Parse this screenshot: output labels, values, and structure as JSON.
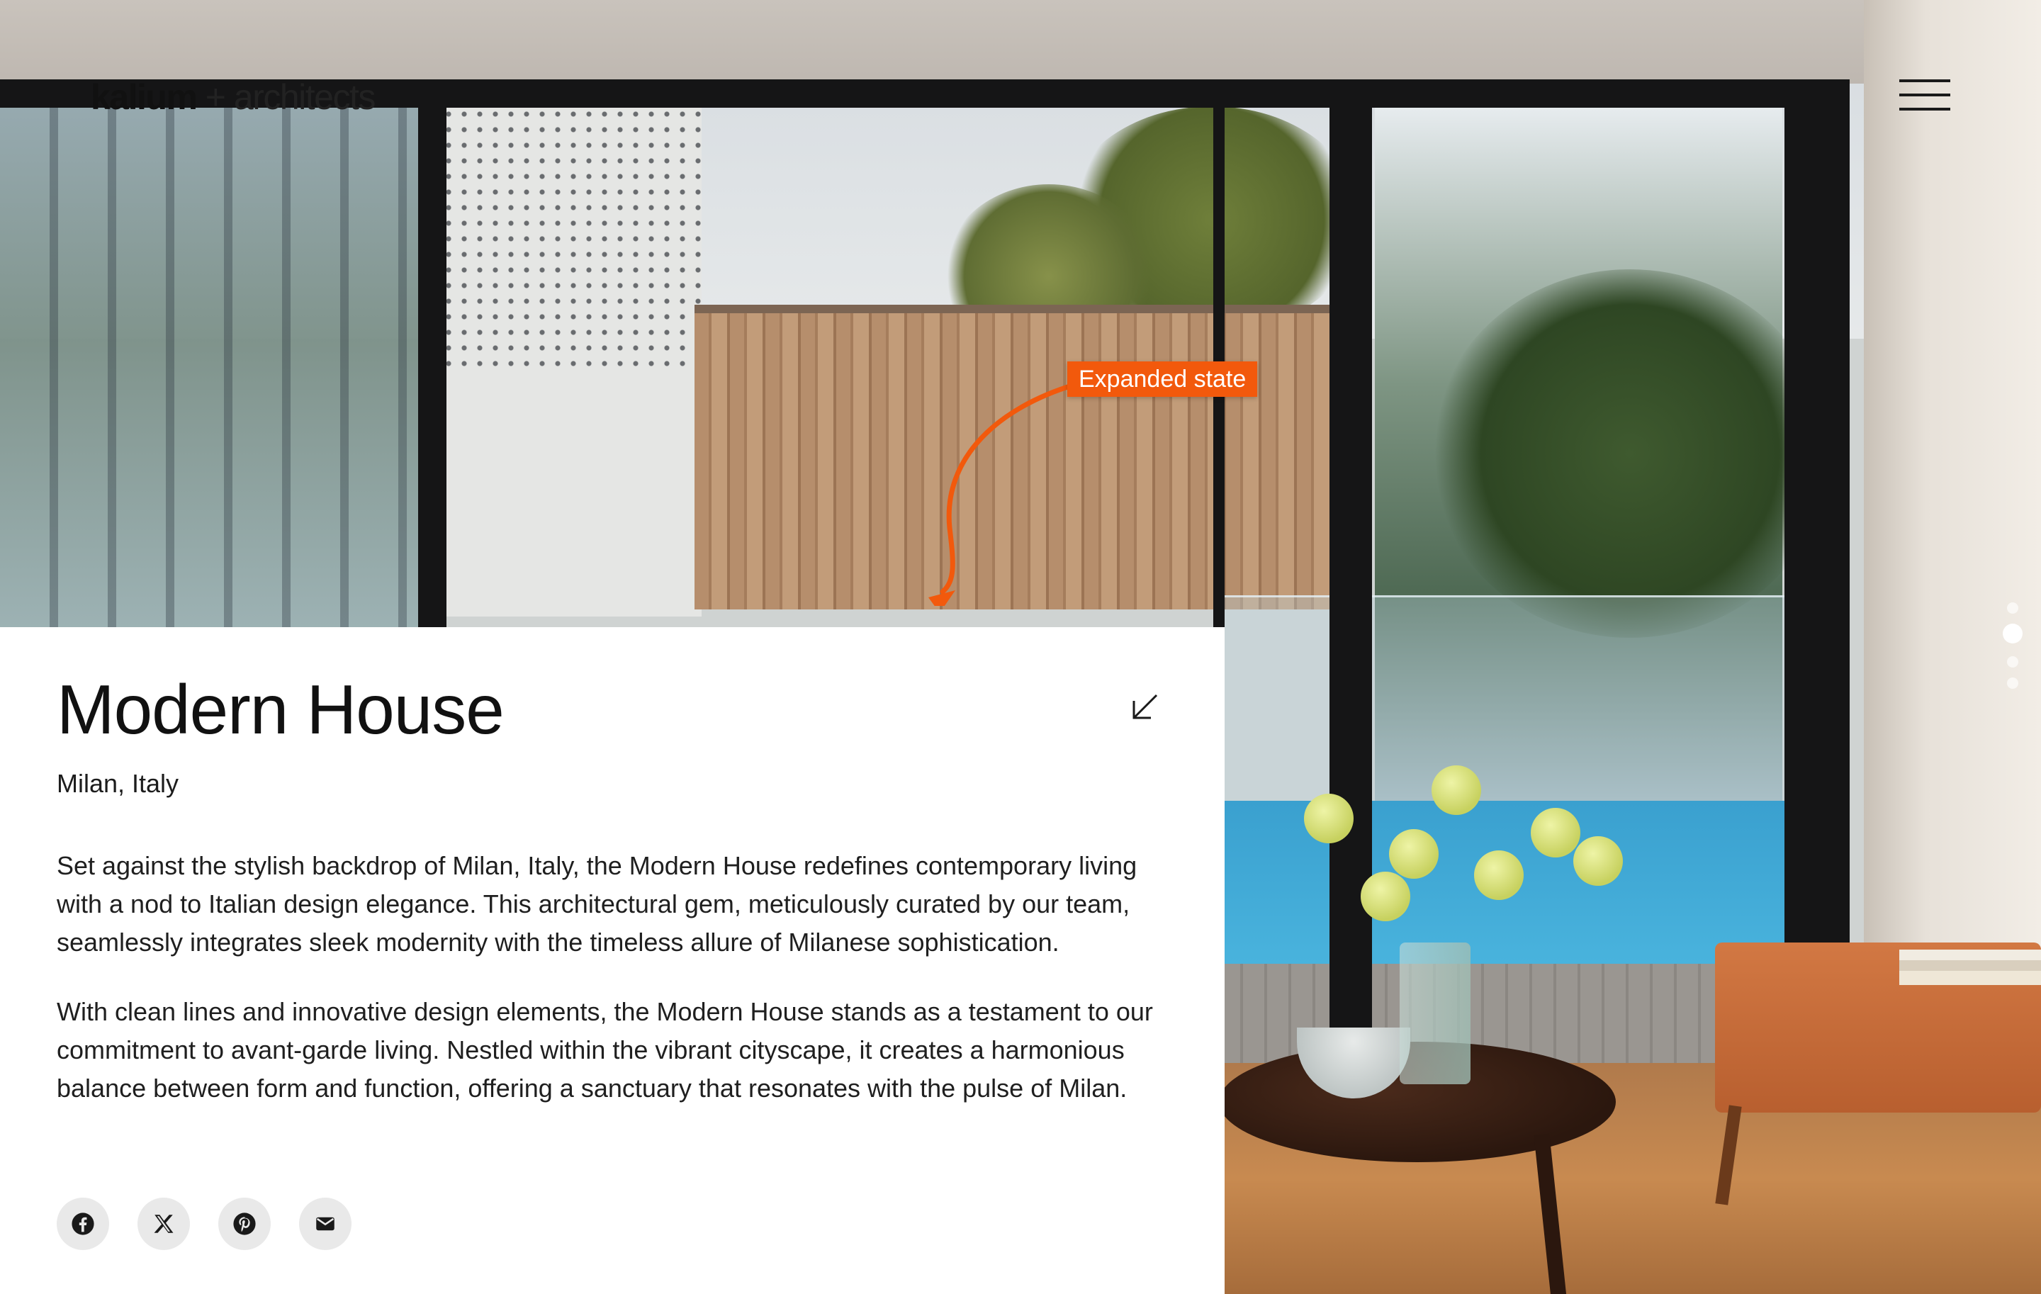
{
  "header": {
    "logo_brand": "kalium",
    "logo_rest": " + architects",
    "menu_icon": "hamburger-menu-icon"
  },
  "annotation": {
    "label": "Expanded state",
    "color": "#f2590c"
  },
  "project": {
    "title": "Modern House",
    "location": "Milan, Italy",
    "paragraphs": [
      "Set against the stylish backdrop of Milan, Italy, the Modern House redefines contemporary living with a nod to Italian design elegance. This architectural gem, meticulously curated by our team, seamlessly integrates sleek modernity with the timeless allure of Milanese sophistication.",
      "With clean lines and innovative design elements, the Modern House stands as a testament to our commitment to avant-garde living. Nestled within the vibrant cityscape, it creates a harmonious balance between form and function, offering a sanctuary that resonates with the pulse of Milan."
    ],
    "collapse_icon": "arrow-down-left-icon"
  },
  "social": [
    {
      "icon": "facebook-icon"
    },
    {
      "icon": "x-twitter-icon"
    },
    {
      "icon": "pinterest-icon"
    },
    {
      "icon": "email-icon"
    }
  ],
  "slider": {
    "slide_count": 4,
    "active_slide": 2
  }
}
